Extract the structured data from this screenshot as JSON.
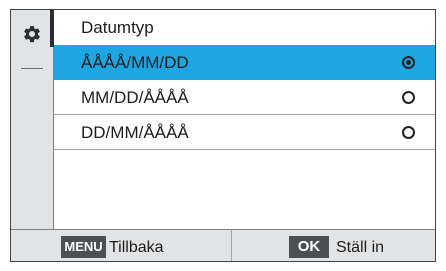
{
  "header": {
    "title": "Datumtyp"
  },
  "sidebar": {
    "icon": "gear-icon"
  },
  "options": [
    {
      "label": "ÅÅÅÅ/MM/DD",
      "selected": true
    },
    {
      "label": "MM/DD/ÅÅÅÅ",
      "selected": false
    },
    {
      "label": "DD/MM/ÅÅÅÅ",
      "selected": false
    }
  ],
  "footer": {
    "back_key": "MENU",
    "back_label": "Tillbaka",
    "ok_key": "OK",
    "ok_label": "Ställ in"
  },
  "colors": {
    "highlight": "#1ea6e2",
    "rail": "#e2e3e5",
    "badge": "#4c4f54"
  }
}
